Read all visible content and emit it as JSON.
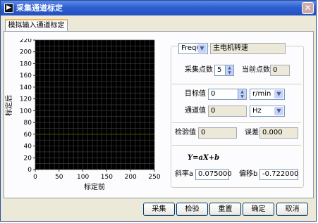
{
  "window": {
    "title": "采集通道标定",
    "app_icon": "labview-arrow-icon",
    "close_glyph": "✕"
  },
  "tab": {
    "label": "模拟输入通道标定"
  },
  "chart_data": {
    "type": "line",
    "xlabel": "标定前",
    "ylabel": "标定后",
    "xlim": [
      0,
      250
    ],
    "ylim": [
      0,
      220
    ],
    "x_ticks": [
      "0",
      "50",
      "100",
      "150",
      "200",
      "250"
    ],
    "y_ticks": [
      "0",
      "20",
      "40",
      "60",
      "80",
      "100",
      "120",
      "140",
      "160",
      "180",
      "200",
      "220"
    ],
    "grid": true,
    "background": "#000000",
    "grid_color": "#3a3a3a",
    "series": [
      {
        "color": "#4f4f00",
        "x": [
          0,
          250
        ],
        "y": [
          60,
          60
        ]
      }
    ]
  },
  "channel": {
    "selected": "Freq0",
    "name": "主电机转速"
  },
  "sampling": {
    "count_label": "采集点数",
    "count_value": "5",
    "current_label": "当前点数",
    "current_value": "0"
  },
  "target": {
    "label": "目标值",
    "value": "0",
    "unit": "r/min"
  },
  "channel_value": {
    "label": "通道值",
    "value": "0",
    "unit": "Hz"
  },
  "check": {
    "label": "检验值",
    "value": "0",
    "error_label": "误差",
    "error_value": "0.000"
  },
  "formula": {
    "text": "Y=aX+b"
  },
  "coeff": {
    "slope_label": "斜率a",
    "slope_value": "0.075000",
    "offset_label": "偏移b",
    "offset_value": "-0.722000"
  },
  "buttons": {
    "sample": "采集",
    "verify": "检验",
    "reset": "重置",
    "ok": "确定",
    "cancel": "取消"
  },
  "colors": {
    "titlebar": "#2d5fd0",
    "panel": "#ece9d8"
  }
}
